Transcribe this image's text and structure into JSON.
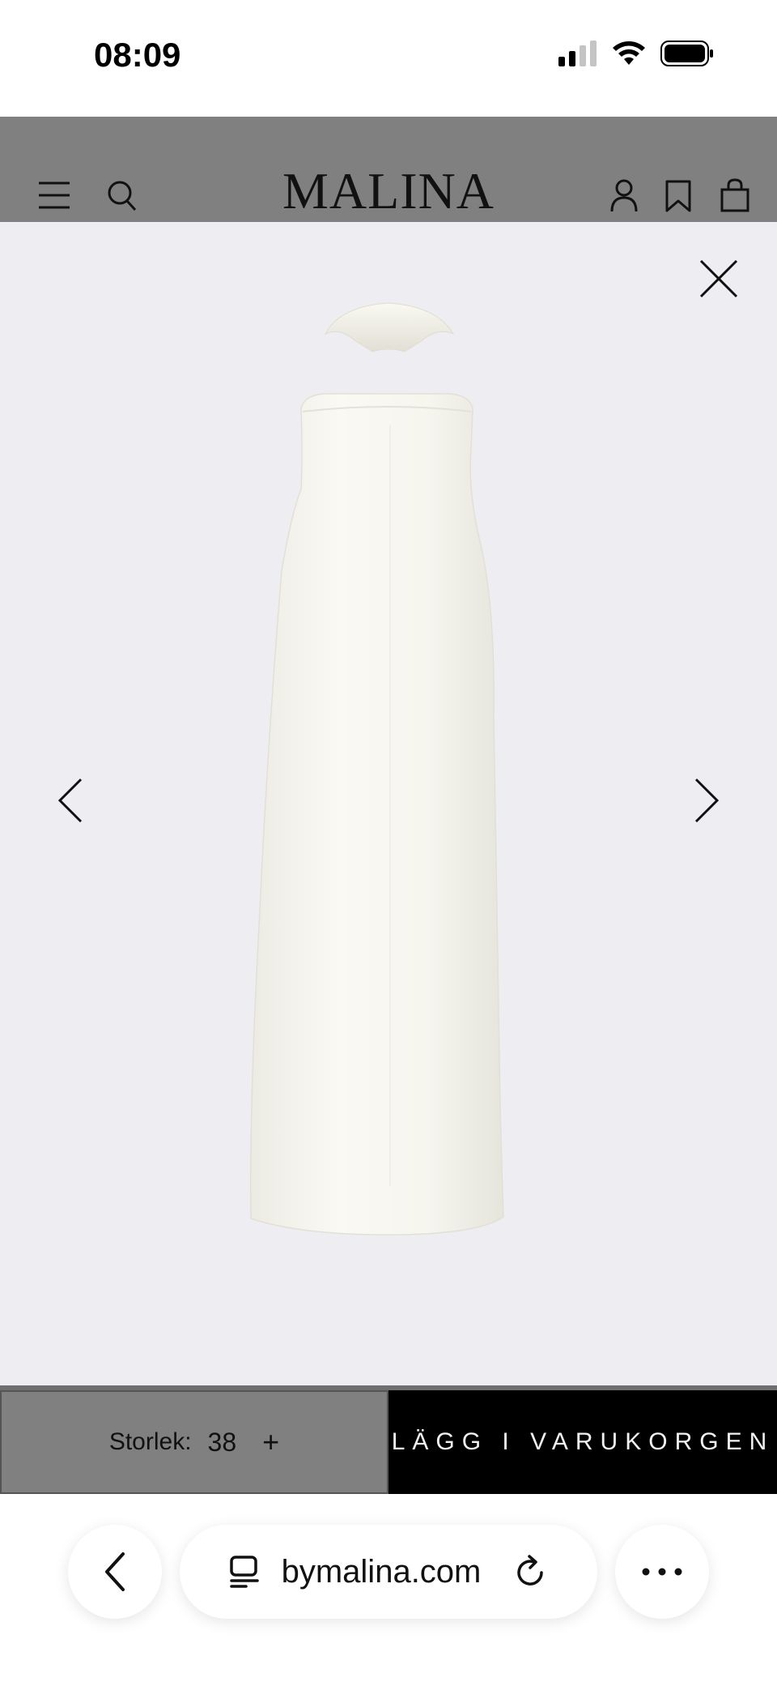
{
  "status_bar": {
    "time": "08:09"
  },
  "header": {
    "logo": "MALINA"
  },
  "icons": {
    "menu": "menu-icon",
    "search": "search-icon",
    "account": "account-icon",
    "wishlist": "bookmark-icon",
    "bag": "shopping-bag-icon",
    "close": "close-icon",
    "prev": "chevron-left-icon",
    "next": "chevron-right-icon"
  },
  "product_image": {
    "description_visible": false
  },
  "action_bar": {
    "size_label": "Storlek:",
    "size_value": "38",
    "size_plus": "+",
    "add_to_cart_label": "LÄGG I VARUKORGEN"
  },
  "browser": {
    "url": "bymalina.com"
  },
  "colors": {
    "header_bg": "#808080",
    "viewer_bg": "#eeeef2",
    "cart_button_bg": "#000000",
    "dress": "#f7f6f0"
  }
}
